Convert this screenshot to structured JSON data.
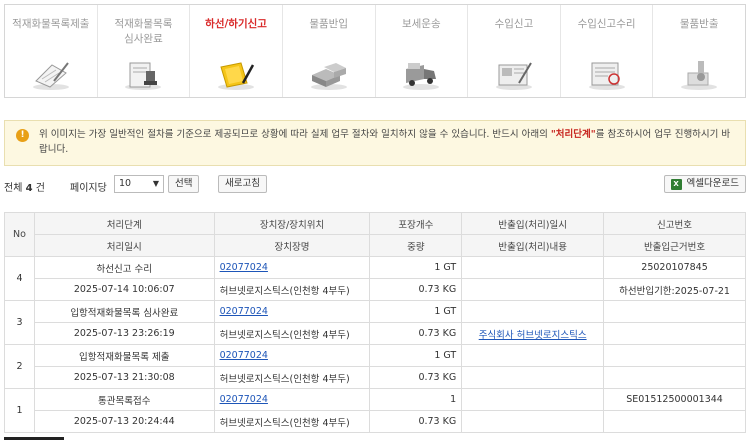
{
  "steps": [
    {
      "label": "적재화물목록제출",
      "icon": "clipboard-pen-icon",
      "active": false
    },
    {
      "label": "적재화물목록\n심사완료",
      "icon": "document-stamp-icon",
      "active": false
    },
    {
      "label": "하선/하기신고",
      "icon": "folder-pen-icon",
      "active": true
    },
    {
      "label": "물품반입",
      "icon": "boxes-icon",
      "active": false
    },
    {
      "label": "보세운송",
      "icon": "truck-icon",
      "active": false
    },
    {
      "label": "수입신고",
      "icon": "form-pen-icon",
      "active": false
    },
    {
      "label": "수입신고수리",
      "icon": "stamped-form-icon",
      "active": false
    },
    {
      "label": "물품반출",
      "icon": "release-icon",
      "active": false
    }
  ],
  "notice": {
    "icon": "!",
    "text_before": "위 이미지는 가장 일반적인 절차를 기준으로 제공되므로 상황에 따라 실제 업무 절차와 일치하지 않을 수 있습니다. 반드시 아래의 ",
    "highlight": "\"처리단계\"",
    "text_after": "를 참조하시어 업무 진행하시기 바랍니다."
  },
  "toolbar": {
    "total_prefix": "전체",
    "total_count": "4",
    "total_suffix": "건",
    "per_page_label": "페이지당",
    "per_page_value": "10",
    "choose_label": "선택",
    "refresh_label": "새로고침",
    "excel_label": "엑셀다운로드"
  },
  "table": {
    "headers": {
      "no": "No",
      "row1": [
        "처리단계",
        "장치장/장치위치",
        "포장개수",
        "반출입(처리)일시",
        "신고번호"
      ],
      "row2": [
        "처리일시",
        "장치장명",
        "중량",
        "반출입(처리)내용",
        "반출입근거번호"
      ]
    },
    "rows": [
      {
        "no": "4",
        "step": "하선신고 수리",
        "location": "02077024",
        "packages": "1 GT",
        "inout_time": "",
        "report_no": "25020107845",
        "datetime": "2025-07-14 10:06:07",
        "location_name": "허브넷로지스틱스(인천항 4부두)",
        "weight": "0.73 KG",
        "inout_content": "",
        "basis_no": "하선반입기한:2025-07-21"
      },
      {
        "no": "3",
        "step": "입항적재화물목록 심사완료",
        "location": "02077024",
        "packages": "1 GT",
        "inout_time": "",
        "report_no": "",
        "datetime": "2025-07-13 23:26:19",
        "location_name": "허브넷로지스틱스(인천항 4부두)",
        "weight": "0.73 KG",
        "inout_content": "주식회사 허브넷로지스틱스",
        "basis_no": ""
      },
      {
        "no": "2",
        "step": "입항적재화물목록 제출",
        "location": "02077024",
        "packages": "1 GT",
        "inout_time": "",
        "report_no": "",
        "datetime": "2025-07-13 21:30:08",
        "location_name": "허브넷로지스틱스(인천항 4부두)",
        "weight": "0.73 KG",
        "inout_content": "",
        "basis_no": ""
      },
      {
        "no": "1",
        "step": "통관목록접수",
        "location": "02077024",
        "packages": "1",
        "inout_time": "",
        "report_no": "SE01512500001344",
        "datetime": "2025-07-13 20:24:44",
        "location_name": "허브넷로지스틱스(인천항 4부두)",
        "weight": "0.73 KG",
        "inout_content": "",
        "basis_no": ""
      }
    ]
  }
}
